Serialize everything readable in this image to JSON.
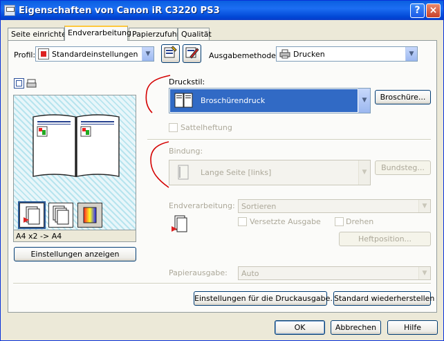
{
  "window": {
    "title": "Eigenschaften von Canon iR C3220 PS3"
  },
  "tabs": [
    "Seite einrichten",
    "Endverarbeitung",
    "Papierzufuhr",
    "Qualität"
  ],
  "profile": {
    "label": "Profil:",
    "value": "Standardeinstellungen"
  },
  "output_method": {
    "label": "Ausgabemethode:",
    "value": "Drucken"
  },
  "preview": {
    "caption": "A4 x2 -> A4"
  },
  "settings_button": "Einstellungen anzeigen",
  "druckstil": {
    "label": "Druckstil:",
    "value": "Broschürendruck",
    "button": "Broschüre..."
  },
  "saddle": {
    "label": "Sattelheftung"
  },
  "binding": {
    "label": "Bindung:",
    "value": "Lange Seite [links]",
    "button": "Bundsteg..."
  },
  "finishing": {
    "label": "Endverarbeitung:",
    "value": "Sortieren"
  },
  "offset": {
    "label": "Versetzte Ausgabe"
  },
  "rotate": {
    "label": "Drehen"
  },
  "staple_button": "Heftposition...",
  "paper_output": {
    "label": "Papierausgabe:",
    "value": "Auto"
  },
  "buttons": {
    "output_settings": "Einstellungen für die Druckausgabe...",
    "restore_defaults": "Standard wiederherstellen",
    "ok": "OK",
    "cancel": "Abbrechen",
    "help": "Hilfe"
  },
  "icons": [
    "printer-icon",
    "book-icon",
    "profile-add-icon",
    "profile-edit-icon"
  ],
  "colors": {
    "selection": "#316ac5",
    "title_bar": "#0a5fe0",
    "annotation": "#d40000"
  }
}
